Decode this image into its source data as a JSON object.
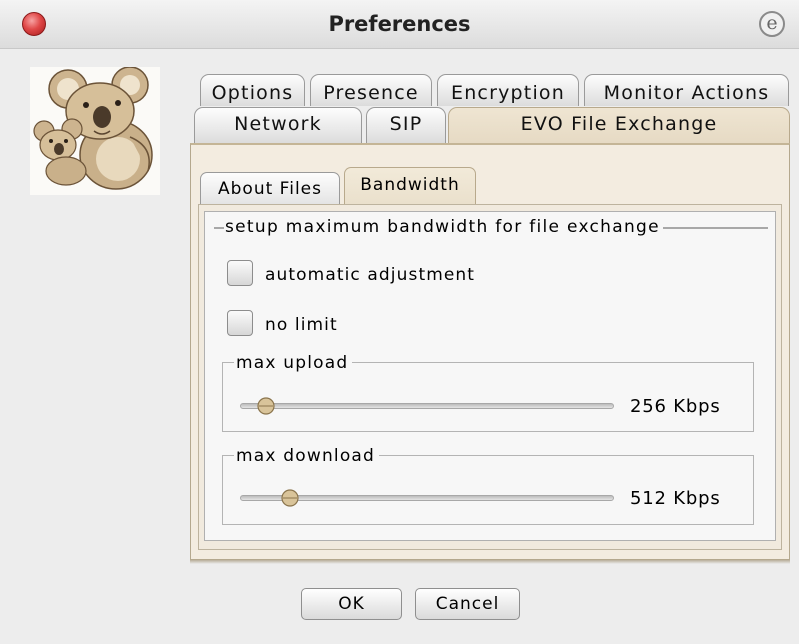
{
  "window": {
    "title": "Preferences",
    "icons": {
      "close": "close-icon",
      "menu": "e-menu-icon"
    }
  },
  "avatar": {
    "icon": "koala-icon"
  },
  "tabs": {
    "row1": [
      "Options",
      "Presence",
      "Encryption",
      "Monitor Actions"
    ],
    "row2": [
      "Network",
      "SIP",
      "EVO File Exchange"
    ],
    "selected": "EVO File Exchange"
  },
  "subtabs": {
    "items": [
      "About Files",
      "Bandwidth"
    ],
    "selected": "Bandwidth"
  },
  "bandwidth": {
    "group_title": "setup maximum bandwidth for file exchange",
    "automatic": {
      "label": "automatic adjustment",
      "checked": false
    },
    "nolimit": {
      "label": "no limit",
      "checked": false
    },
    "upload": {
      "title": "max upload",
      "value": "256 Kbps",
      "level": 0.045
    },
    "download": {
      "title": "max download",
      "value": "512 Kbps",
      "level": 0.11
    }
  },
  "buttons": {
    "ok": "OK",
    "cancel": "Cancel"
  },
  "colors": {
    "accent_tab": "#e9dec9",
    "panel": "#f3ece0",
    "close": "#e04848"
  }
}
